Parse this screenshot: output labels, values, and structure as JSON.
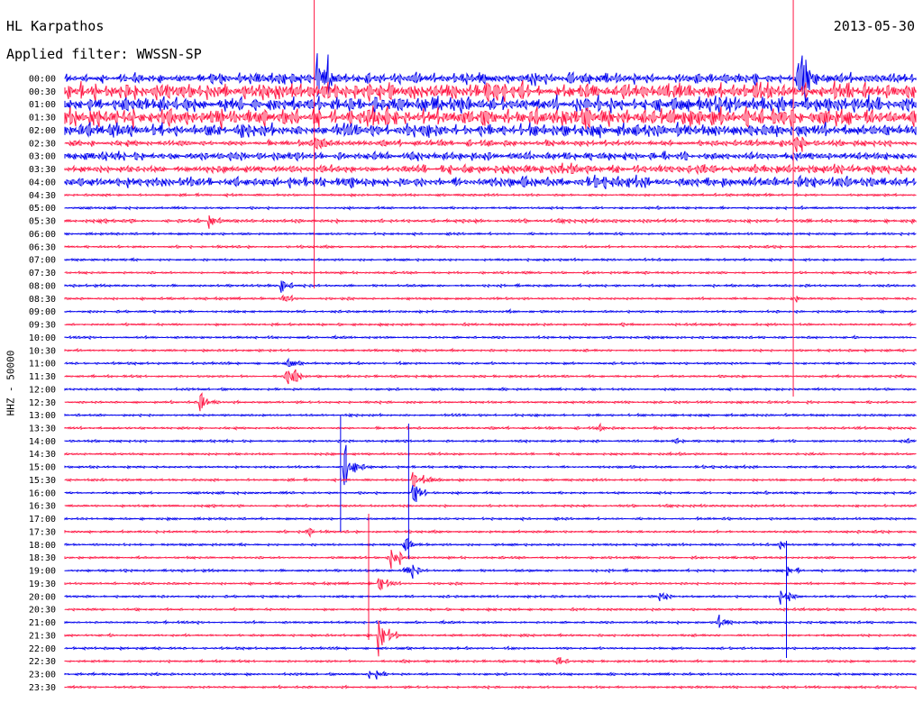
{
  "header": {
    "station": "HL Karpathos",
    "date": "2013-05-30",
    "filter_label": "Applied filter: WWSSN-SP"
  },
  "channel_label": "HHZ - 50000",
  "chart_data": {
    "type": "line",
    "title": "HL Karpathos",
    "date": "2013-05-30",
    "filter": "WWSSN-SP",
    "ylabel": "HHZ - 50000",
    "row_labels": [
      "00:00",
      "00:30",
      "01:00",
      "01:30",
      "02:00",
      "02:30",
      "03:00",
      "03:30",
      "04:00",
      "04:30",
      "05:00",
      "05:30",
      "06:00",
      "06:30",
      "07:00",
      "07:30",
      "08:00",
      "08:30",
      "09:00",
      "09:30",
      "10:00",
      "10:30",
      "11:00",
      "11:30",
      "12:00",
      "12:30",
      "13:00",
      "13:30",
      "14:00",
      "14:30",
      "15:00",
      "15:30",
      "16:00",
      "16:30",
      "17:00",
      "17:30",
      "18:00",
      "18:30",
      "19:00",
      "19:30",
      "20:00",
      "20:30",
      "21:00",
      "21:30",
      "22:00",
      "22:30",
      "23:00",
      "23:30"
    ],
    "colors": {
      "even_rows": "#0000ee",
      "odd_rows": "#ff1744"
    },
    "x_range_fraction": [
      0,
      1
    ],
    "background_noise": [
      9,
      14,
      13,
      16,
      11,
      5,
      7,
      6,
      9,
      2,
      2,
      3,
      2,
      2,
      2,
      2,
      2,
      2,
      2,
      2,
      2,
      2,
      2,
      2,
      2,
      2,
      2,
      2,
      2,
      2,
      2,
      2,
      2,
      2,
      2,
      2,
      2,
      2,
      2,
      2,
      2,
      2,
      2,
      2,
      2,
      2,
      2,
      2
    ],
    "noise_bursts": [
      {
        "row": 6,
        "start": 0.0,
        "end": 0.3,
        "amp": 5
      },
      {
        "row": 7,
        "start": 0.4,
        "end": 1.0,
        "amp": 8
      },
      {
        "row": 8,
        "start": 0.0,
        "end": 0.22,
        "amp": 7
      }
    ],
    "events": [
      {
        "row": 0,
        "x": 0.296,
        "amp": 90
      },
      {
        "row": 0,
        "x": 0.86,
        "amp": 90
      },
      {
        "row": 5,
        "x": 0.296,
        "amp": 28
      },
      {
        "row": 5,
        "x": 0.86,
        "amp": 22
      },
      {
        "row": 11,
        "x": 0.17,
        "amp": 16
      },
      {
        "row": 16,
        "x": 0.255,
        "amp": 16
      },
      {
        "row": 17,
        "x": 0.255,
        "amp": 14
      },
      {
        "row": 17,
        "x": 0.855,
        "amp": 8
      },
      {
        "row": 18,
        "x": 0.52,
        "amp": 8
      },
      {
        "row": 19,
        "x": 0.65,
        "amp": 8
      },
      {
        "row": 22,
        "x": 0.26,
        "amp": 12
      },
      {
        "row": 23,
        "x": 0.26,
        "amp": 22
      },
      {
        "row": 25,
        "x": 0.16,
        "amp": 18
      },
      {
        "row": 27,
        "x": 0.63,
        "amp": 8
      },
      {
        "row": 28,
        "x": 0.72,
        "amp": 6
      },
      {
        "row": 28,
        "x": 0.99,
        "amp": 6
      },
      {
        "row": 30,
        "x": 0.33,
        "amp": 40
      },
      {
        "row": 31,
        "x": 0.41,
        "amp": 40
      },
      {
        "row": 32,
        "x": 0.41,
        "amp": 32
      },
      {
        "row": 35,
        "x": 0.28,
        "amp": 20
      },
      {
        "row": 36,
        "x": 0.4,
        "amp": 18
      },
      {
        "row": 36,
        "x": 0.84,
        "amp": 10
      },
      {
        "row": 37,
        "x": 0.38,
        "amp": 30
      },
      {
        "row": 38,
        "x": 0.4,
        "amp": 20
      },
      {
        "row": 38,
        "x": 0.85,
        "amp": 18
      },
      {
        "row": 39,
        "x": 0.37,
        "amp": 24
      },
      {
        "row": 40,
        "x": 0.7,
        "amp": 12
      },
      {
        "row": 40,
        "x": 0.84,
        "amp": 24
      },
      {
        "row": 42,
        "x": 0.77,
        "amp": 14
      },
      {
        "row": 43,
        "x": 0.37,
        "amp": 30
      },
      {
        "row": 45,
        "x": 0.58,
        "amp": 12
      },
      {
        "row": 46,
        "x": 0.36,
        "amp": 16
      }
    ]
  }
}
